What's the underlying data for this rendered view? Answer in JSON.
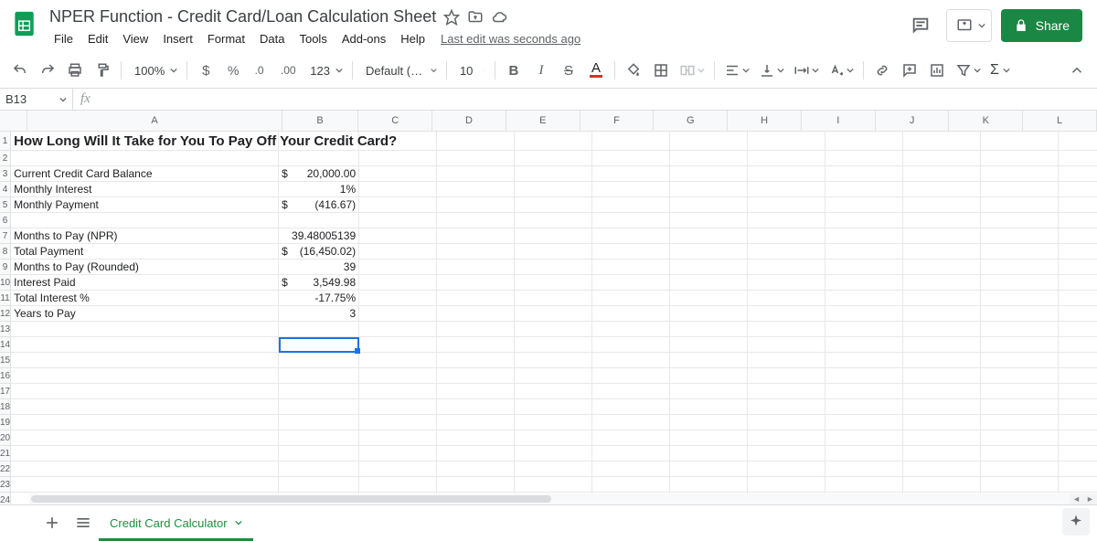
{
  "header": {
    "doc_title": "NPER Function - Credit Card/Loan Calculation Sheet",
    "last_edit": "Last edit was seconds ago",
    "share_label": "Share"
  },
  "menubar": [
    "File",
    "Edit",
    "View",
    "Insert",
    "Format",
    "Data",
    "Tools",
    "Add-ons",
    "Help"
  ],
  "toolbar": {
    "zoom": "100%",
    "font": "Default (Ari...",
    "font_size": "10",
    "num_123": "123"
  },
  "namebox": {
    "cell_ref": "B13"
  },
  "columns": [
    "A",
    "B",
    "C",
    "D",
    "E",
    "F",
    "G",
    "H",
    "I",
    "J",
    "K",
    "L"
  ],
  "sheet": {
    "title_cell": "How Long Will It Take for You To Pay Off Your Credit Card?",
    "rows": [
      {
        "a": "Current Credit Card Balance",
        "b_sym": "$",
        "b": "20,000.00"
      },
      {
        "a": "Monthly Interest",
        "b_sym": "",
        "b": "1%"
      },
      {
        "a": "Monthly Payment",
        "b_sym": "$",
        "b": "(416.67)"
      },
      {
        "a": "",
        "b_sym": "",
        "b": ""
      },
      {
        "a": "Months to Pay (NPR)",
        "b_sym": "",
        "b": "39.48005139"
      },
      {
        "a": "Total Payment",
        "b_sym": "$",
        "b": "(16,450.02)"
      },
      {
        "a": "Months to Pay (Rounded)",
        "b_sym": "",
        "b": "39"
      },
      {
        "a": "Interest Paid",
        "b_sym": "$",
        "b": "3,549.98"
      },
      {
        "a": "Total Interest %",
        "b_sym": "",
        "b": "-17.75%"
      },
      {
        "a": "Years to Pay",
        "b_sym": "",
        "b": "3"
      }
    ]
  },
  "footer": {
    "sheet_name": "Credit Card Calculator"
  }
}
